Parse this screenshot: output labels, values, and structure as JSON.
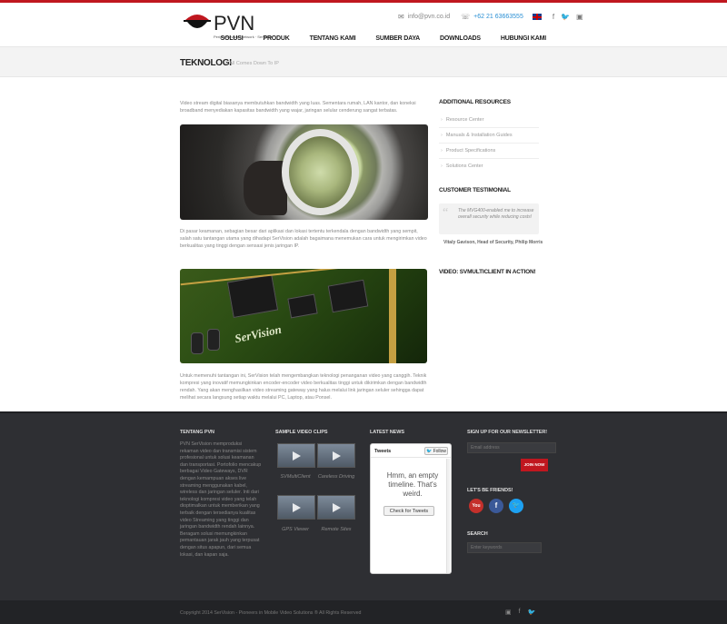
{
  "header": {
    "logo_text": "PVN",
    "logo_sub": "Peripheral vision network · SerVision",
    "email": "info@pvn.co.id",
    "phone": "+62 21 63663555",
    "social_icons": [
      "facebook-icon",
      "twitter-icon",
      "youtube-icon"
    ]
  },
  "nav": [
    "SOLUSI",
    "PRODUK",
    "TENTANG KAMI",
    "SUMBER DAYA",
    "DOWNLOADS",
    "HUBUNGI KAMI"
  ],
  "page": {
    "title": "TEKNOLOGI",
    "subtitle": "It All Comes Down To IP",
    "para1": "Video stream digital biasanya membutuhkan bandwidth yang luas. Sementara rumah, LAN kantor, dan koneksi broadband menyediakan kapasitas bandwidth yang wajar, jaringan selular cenderung sangat terbatas.",
    "para2": "Di pasar keamanan, sebagian besar dari aplikasi dan lokasi tertentu terkendala dengan bandwidth yang sempit, salah satu tantangan utama yang dihadapi SerVision adalah bagaimana menemukan cara untuk mengirimkan video berkualitas yang tinggi dengan sensasi jenis jaringan IP.",
    "para3": "Untuk memenuhi tantangan ini, SerVision telah mengembangkan teknologi penanganan video yang canggih. Teknik kompresi yang inovatif memungkinkan encoder-encoder video berkualitas tinggi untuk dikirimkan dengan bandwidth rendah. Yang akan menghasilkan video streaming gateway yang halus melalui link jaringan seluler sehingga dapat melihat secara langsung setiap waktu melalui PC, Laptop, atau Ponsel.",
    "img2_text": "SerVision"
  },
  "sidebar": {
    "resources_title": "ADDITIONAL RESOURCES",
    "links": [
      "Resource Center",
      "Manuals & Installation Guides",
      "Product Specifications",
      "Solutions Center"
    ],
    "testimonial_title": "CUSTOMER TESTIMONIAL",
    "quote": "The MVG400-enabled me to increase overall security while reducing costs!",
    "author": "Vitaly Gavison, Head of Security, Philip Morris",
    "video_title": "VIDEO: SVMULTICLIENT IN ACTION!"
  },
  "footer": {
    "about_title": "TENTANG PVN",
    "about_text": "PVN SerVision memproduksi rekaman video dan transmisi sistem profesional untuk solusi keamanan dan transportasi. Portofolio mencakup berbagai Video Gateways, DVR dengan kemampuan akses live streaming menggunakan kabel, wireless dan jaringan seluler. Inti dari teknologi kompresi video yang telah dioptimalkan untuk memberikan yang terbaik dengan tersedianya kualitas video Streaming yang tinggi dan jaringan bandwidth rendah lainnya. Beragam solusi memungkinkan pemantauan jarak jauh yang terpusat dengan situs apapun, dari semua lokasi, dan kapan saja.",
    "clips_title": "SAMPLE VIDEO CLIPS",
    "clips": [
      "SVMultiClient",
      "Careless Driving",
      "GPS Viewer",
      "Remote Sites"
    ],
    "news_title": "LATEST NEWS",
    "tweets_title": "Tweets",
    "follow_label": "Follow",
    "empty_timeline": "Hmm, an empty timeline. That's weird.",
    "check_label": "Check for Tweets",
    "newsletter_title": "SIGN UP FOR OUR NEWSLETTER!",
    "email_placeholder": "Email address",
    "join_label": "JOIN NOW",
    "friends_title": "LET'S BE FRIENDS!",
    "search_title": "SEARCH",
    "search_placeholder": "Enter keywords",
    "copyright": "Copyright 2014 SerVision - Pioneers in Mobile Video Solutions ® All Rights Reserved"
  },
  "colors": {
    "accent": "#c0171f",
    "footer_bg": "#2e2f33",
    "link_blue": "#2a8fd4"
  }
}
